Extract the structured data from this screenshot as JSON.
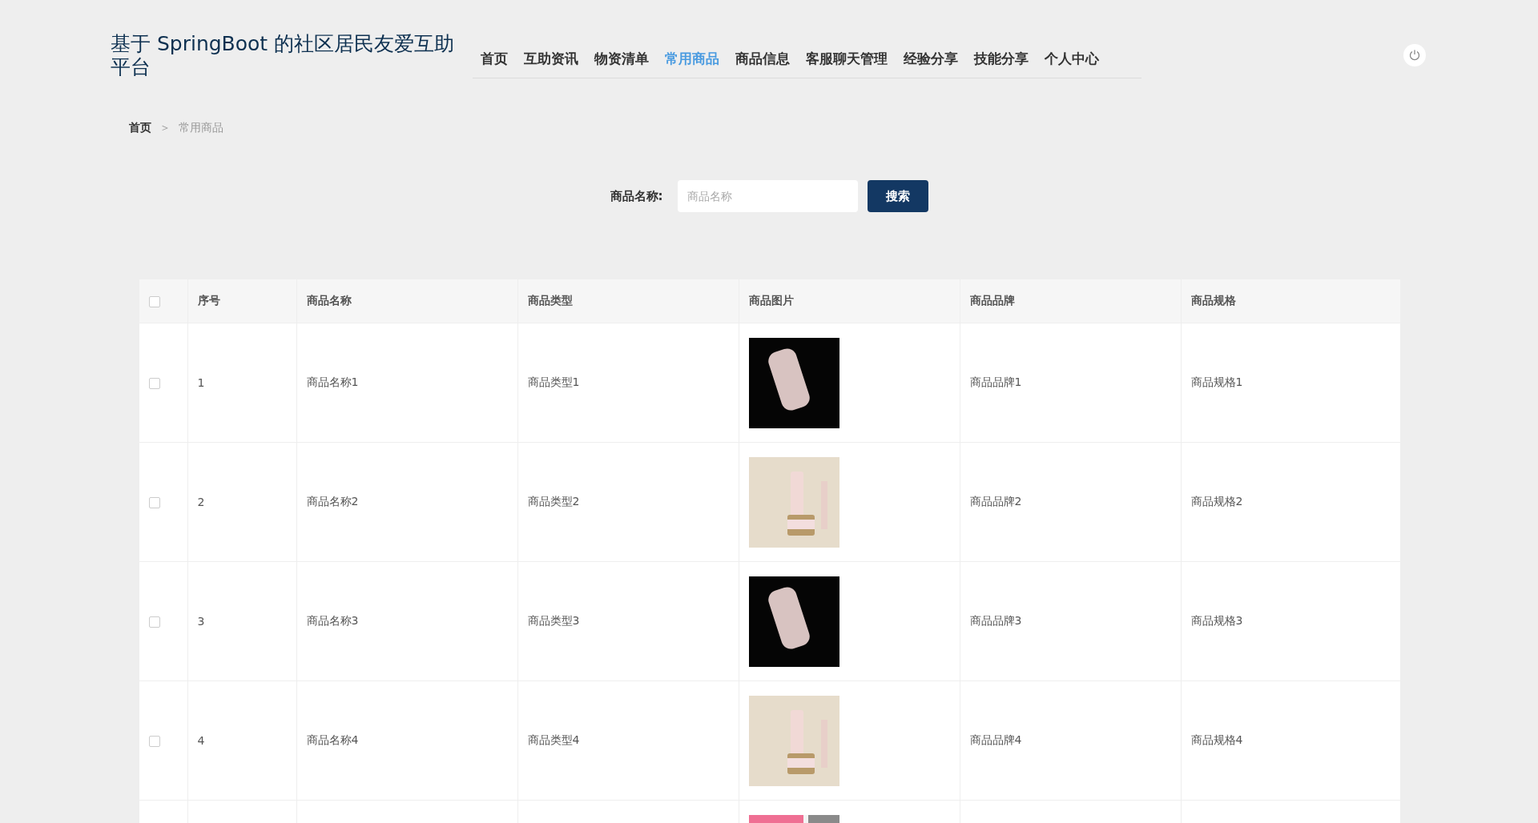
{
  "site_title": "基于 SpringBoot 的社区居民友爱互助平台",
  "nav": [
    {
      "label": "首页",
      "selected": false
    },
    {
      "label": "互助资讯",
      "selected": false
    },
    {
      "label": "物资清单",
      "selected": false
    },
    {
      "label": "常用商品",
      "selected": true
    },
    {
      "label": "商品信息",
      "selected": false
    },
    {
      "label": "客服聊天管理",
      "selected": false
    },
    {
      "label": "经验分享",
      "selected": false
    },
    {
      "label": "技能分享",
      "selected": false
    },
    {
      "label": "个人中心",
      "selected": false
    }
  ],
  "breadcrumb": [
    "首页",
    "＞",
    "常用商品"
  ],
  "search": {
    "label": "商品名称:",
    "placeholder": "商品名称",
    "button": "搜索"
  },
  "table": {
    "header_checked": false,
    "columns": [
      "序号",
      "商品名称",
      "商品类型",
      "商品图片",
      "商品品牌",
      "商品规格"
    ],
    "rows": [
      {
        "checked": false,
        "cells": [
          "1",
          "商品名称1",
          "商品类型1",
          "",
          "商品品牌1",
          "商品规格1"
        ],
        "kind": "phone"
      },
      {
        "checked": false,
        "cells": [
          "2",
          "商品名称2",
          "商品类型2",
          "",
          "商品品牌2",
          "商品规格2"
        ],
        "kind": "cosmetics"
      },
      {
        "checked": false,
        "cells": [
          "3",
          "商品名称3",
          "商品类型3",
          "",
          "商品品牌3",
          "商品规格3"
        ],
        "kind": "phone"
      },
      {
        "checked": false,
        "cells": [
          "4",
          "商品名称4",
          "商品类型4",
          "",
          "商品品牌4",
          "商品规格4"
        ],
        "kind": "cosmetics"
      },
      {
        "cells": [
          "",
          "",
          "",
          "",
          "",
          ""
        ],
        "kind": "banner"
      }
    ]
  }
}
